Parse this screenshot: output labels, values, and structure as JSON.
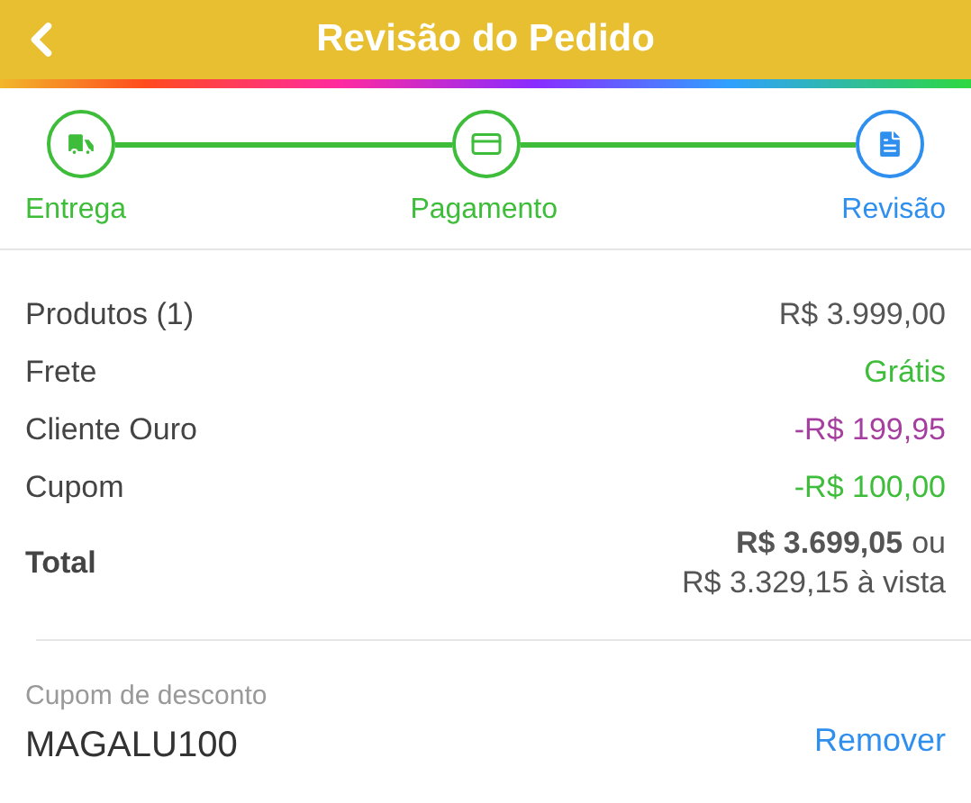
{
  "header": {
    "title": "Revisão do Pedido"
  },
  "steps": [
    {
      "label": "Entrega",
      "kind": "delivery",
      "completed": true
    },
    {
      "label": "Pagamento",
      "kind": "payment",
      "completed": true
    },
    {
      "label": "Revisão",
      "kind": "review",
      "completed": false
    }
  ],
  "summary": [
    {
      "label": "Produtos (1)",
      "value": "R$ 3.999,00",
      "color": "#555555"
    },
    {
      "label": "Frete",
      "value": "Grátis",
      "color": "#3dbd3a"
    },
    {
      "label": "Cliente Ouro",
      "value": "-R$ 199,95",
      "color": "#a63ea0"
    },
    {
      "label": "Cupom",
      "value": "-R$ 100,00",
      "color": "#3dbd3a"
    }
  ],
  "total": {
    "label": "Total",
    "installment": "R$ 3.699,05",
    "separator": "ou",
    "cash": "R$ 3.329,15 à vista"
  },
  "coupon": {
    "label": "Cupom de desconto",
    "code": "MAGALU100",
    "action": "Remover"
  }
}
